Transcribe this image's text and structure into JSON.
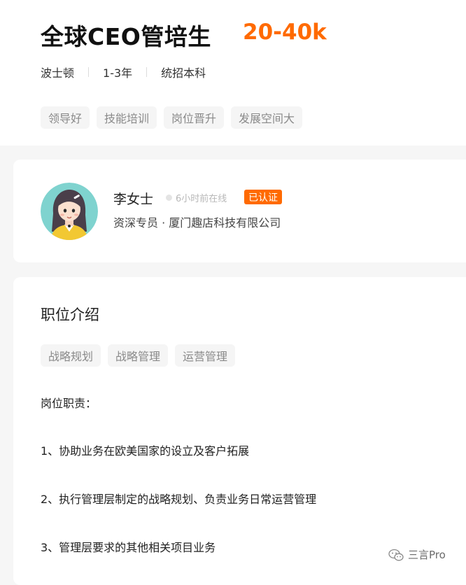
{
  "job": {
    "title": "全球CEO管培生",
    "salary": "20-40k",
    "location": "波士顿",
    "experience": "1-3年",
    "education": "统招本科",
    "benefit_tags": [
      "领导好",
      "技能培训",
      "岗位晋升",
      "发展空间大"
    ]
  },
  "recruiter": {
    "name": "李女士",
    "online_status": "6小时前在线",
    "verified_badge": "已认证",
    "title_company": "资深专员 · 厦门趣店科技有限公司"
  },
  "description": {
    "section_title": "职位介绍",
    "skill_tags": [
      "战略规划",
      "战略管理",
      "运营管理"
    ],
    "heading": "岗位职责：",
    "duties": [
      "1、协助业务在欧美国家的设立及客户拓展",
      "2、执行管理层制定的战略规划、负责业务日常运营管理",
      "3、管理层要求的其他相关项目业务"
    ]
  },
  "watermark": {
    "text": "三言Pro",
    "icon": "wechat-icon"
  },
  "colors": {
    "salary": "#ff6a00",
    "verified_badge": "#ff6a00"
  }
}
